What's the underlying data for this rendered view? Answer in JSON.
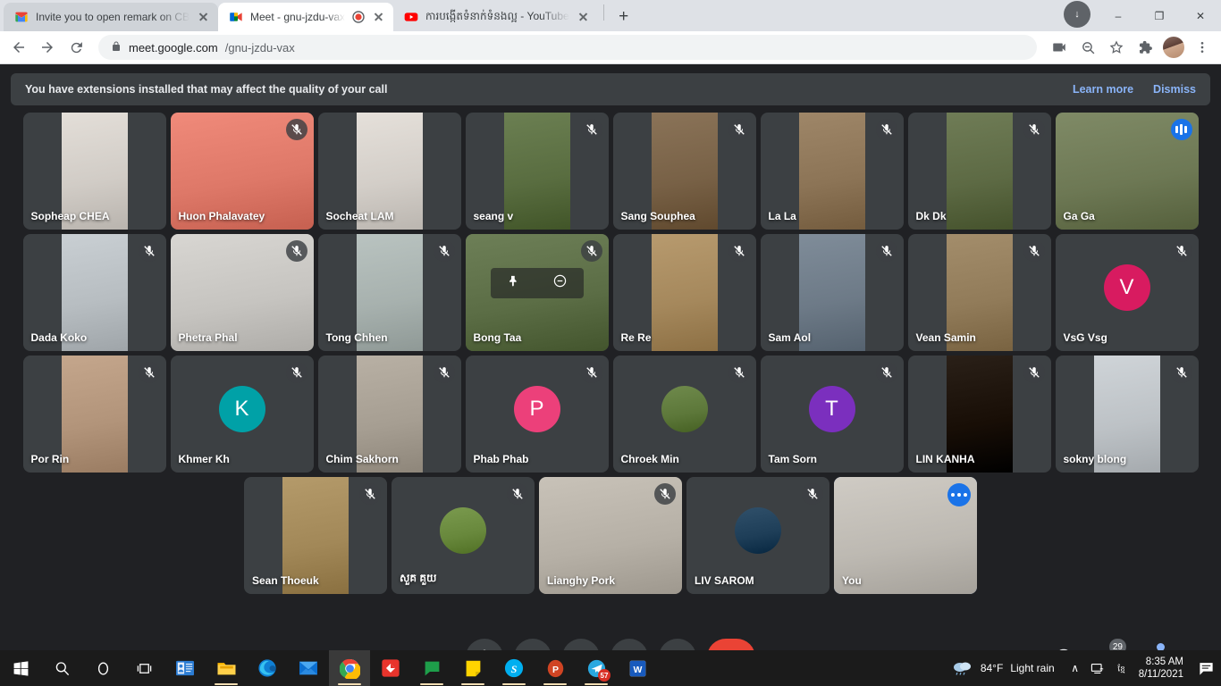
{
  "browser": {
    "tabs": [
      {
        "title": "Invite you to open remark on CBO",
        "favicon": "gmail-icon",
        "active": false,
        "recording": false
      },
      {
        "title": "Meet - gnu-jzdu-vax",
        "favicon": "google-meet-icon",
        "active": true,
        "recording": true
      },
      {
        "title": "ការបង្កើតទំនាក់ទំនងល្អ - YouTube",
        "favicon": "youtube-icon",
        "active": false,
        "recording": false
      }
    ],
    "new_tab_label": "+",
    "window_controls": {
      "minimize": "–",
      "maximize": "❐",
      "close": "✕"
    },
    "download_label": "↓",
    "url_domain": "meet.google.com",
    "url_path": "/gnu-jzdu-vax",
    "lock_icon": "lock-icon"
  },
  "banner": {
    "message": "You have extensions installed that may affect the quality of your call",
    "learn_more": "Learn more",
    "dismiss": "Dismiss"
  },
  "grid": {
    "rows": [
      [
        {
          "name": "Sopheap CHEA",
          "muted": false,
          "kind": "video",
          "tone": "#e3ded8"
        },
        {
          "name": "Huon Phalavatey",
          "muted": true,
          "kind": "video-full",
          "tone": "#f08a7a"
        },
        {
          "name": "Socheat LAM",
          "muted": false,
          "kind": "video",
          "tone": "#e5e0da"
        },
        {
          "name": "seang v",
          "muted": true,
          "kind": "video",
          "tone": "#6b7f52"
        },
        {
          "name": "Sang Souphea",
          "muted": true,
          "kind": "video",
          "tone": "#8a7358"
        },
        {
          "name": "La La",
          "muted": true,
          "kind": "video",
          "tone": "#9e8668"
        },
        {
          "name": "Dk Dk",
          "muted": true,
          "kind": "video",
          "tone": "#6f7c56"
        },
        {
          "name": "Ga Ga",
          "muted": false,
          "speaking": true,
          "kind": "video-full",
          "tone": "#7f8a66"
        }
      ],
      [
        {
          "name": "Dada Koko",
          "muted": true,
          "kind": "video",
          "tone": "#c9cfd3"
        },
        {
          "name": "Phetra Phal",
          "muted": true,
          "kind": "video-full",
          "tone": "#d8d6d2"
        },
        {
          "name": "Tong Chhen",
          "muted": true,
          "kind": "video",
          "tone": "#b9c3c0"
        },
        {
          "name": "Bong Taa",
          "muted": true,
          "kind": "video-full",
          "tone": "#6d7f57",
          "hover": true
        },
        {
          "name": "Re Re",
          "muted": true,
          "kind": "video",
          "tone": "#b79a6e"
        },
        {
          "name": "Sam Aol",
          "muted": true,
          "kind": "video",
          "tone": "#7f8c99"
        },
        {
          "name": "Vean Samin",
          "muted": true,
          "kind": "video",
          "tone": "#a38d6b"
        },
        {
          "name": "VsG Vsg",
          "muted": true,
          "kind": "initial",
          "initial": "V",
          "color": "#d81b60"
        }
      ],
      [
        {
          "name": "Por Rin",
          "muted": true,
          "kind": "video",
          "tone": "#c4a68c"
        },
        {
          "name": "Khmer Kh",
          "muted": true,
          "kind": "initial",
          "initial": "K",
          "color": "#00a1a7"
        },
        {
          "name": "Chim Sakhorn",
          "muted": true,
          "kind": "video",
          "tone": "#b8b0a4"
        },
        {
          "name": "Phab Phab",
          "muted": true,
          "kind": "initial",
          "initial": "P",
          "color": "#ec407a"
        },
        {
          "name": "Chroek Min",
          "muted": true,
          "kind": "photo",
          "tone": "#6f8a4c"
        },
        {
          "name": "Tam Sorn",
          "muted": true,
          "kind": "initial",
          "initial": "T",
          "color": "#7b2fbe"
        },
        {
          "name": "LIN KANHA",
          "muted": true,
          "kind": "video",
          "tone": "#2a2018"
        },
        {
          "name": "sokny blong",
          "muted": true,
          "kind": "video",
          "tone": "#cfd4d8"
        }
      ],
      [
        {
          "name": "Sean Thoeuk",
          "muted": true,
          "kind": "video",
          "tone": "#b49a6a"
        },
        {
          "name": "សួគ គួយ",
          "muted": true,
          "kind": "photo",
          "tone": "#7a9a4e"
        },
        {
          "name": "Lianghy Pork",
          "muted": true,
          "kind": "video-full",
          "tone": "#c8c2b8"
        },
        {
          "name": "LIV SAROM",
          "muted": true,
          "kind": "photo",
          "tone": "#30506a"
        },
        {
          "name": "You",
          "muted": false,
          "self": true,
          "kind": "video-full",
          "tone": "#cfcbc4"
        }
      ]
    ]
  },
  "controls": {
    "time": "8:35 AM",
    "meeting_code": "gnu-jzdu-vax",
    "buttons": [
      {
        "name": "microphone-button",
        "icon": "microphone-icon"
      },
      {
        "name": "camera-button",
        "icon": "video-camera-icon"
      },
      {
        "name": "captions-button",
        "icon": "closed-captions-icon"
      },
      {
        "name": "present-button",
        "icon": "present-screen-icon"
      },
      {
        "name": "more-options-button",
        "icon": "three-dots-vertical-icon"
      },
      {
        "name": "hangup-button",
        "icon": "phone-hangup-icon"
      }
    ],
    "right": [
      {
        "name": "meeting-details-button",
        "icon": "info-icon"
      },
      {
        "name": "participants-button",
        "icon": "people-icon",
        "count": "29"
      },
      {
        "name": "chat-button",
        "icon": "chat-bubble-icon",
        "unread": true
      },
      {
        "name": "activities-button",
        "icon": "shapes-icon"
      }
    ]
  },
  "taskbar": {
    "items": [
      {
        "name": "start-button",
        "icon": "windows-logo-icon"
      },
      {
        "name": "search-button",
        "icon": "magnifier-icon"
      },
      {
        "name": "cortana-button",
        "icon": "circle-icon"
      },
      {
        "name": "task-view-button",
        "icon": "task-view-icon"
      },
      {
        "name": "contacts-app",
        "icon": "people-card-icon",
        "running": false
      },
      {
        "name": "file-explorer",
        "icon": "folder-icon",
        "running": true
      },
      {
        "name": "microsoft-edge",
        "icon": "edge-icon",
        "running": false
      },
      {
        "name": "mail-app",
        "icon": "mail-icon",
        "running": false
      },
      {
        "name": "google-chrome",
        "icon": "chrome-icon",
        "running": true,
        "active": true
      },
      {
        "name": "app-red-diamond",
        "icon": "red-diamond-icon",
        "running": false
      },
      {
        "name": "messages-app",
        "icon": "green-chat-icon",
        "running": true
      },
      {
        "name": "sticky-notes",
        "icon": "yellow-note-icon",
        "running": true
      },
      {
        "name": "skype",
        "icon": "skype-icon",
        "running": true
      },
      {
        "name": "powerpoint",
        "icon": "powerpoint-icon",
        "running": true
      },
      {
        "name": "telegram",
        "icon": "telegram-icon",
        "running": true,
        "badge": "57"
      },
      {
        "name": "word",
        "icon": "word-icon",
        "running": false
      }
    ],
    "tray": {
      "weather_temp": "84°F",
      "weather_desc": "Light rain",
      "chevron": "∧",
      "time": "8:35 AM",
      "date": "8/11/2021"
    }
  }
}
